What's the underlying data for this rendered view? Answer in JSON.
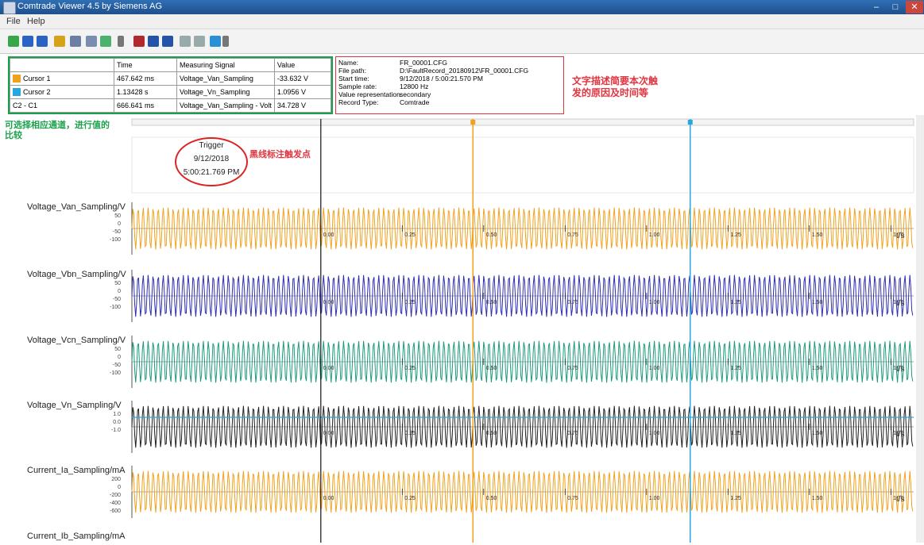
{
  "window": {
    "title": "Comtrade Viewer 4.5 by Siemens AG"
  },
  "menu": [
    "File",
    "Help"
  ],
  "cursor_table": {
    "headers": [
      "",
      "Time",
      "Measuring Signal",
      "Value"
    ],
    "rows": [
      {
        "name": "Cursor 1",
        "color": "#f0a21f",
        "time": "467.642 ms",
        "signal": "Voltage_Van_Sampling",
        "value": "-33.632 V"
      },
      {
        "name": "Cursor 2",
        "color": "#27a7df",
        "time": "1.13428 s",
        "signal": "Voltage_Vn_Sampling",
        "value": "1.0956 V"
      },
      {
        "name": "C2 - C1",
        "color": "",
        "time": "666.641 ms",
        "signal": "Voltage_Van_Sampling - Volt",
        "value": "34.728 V"
      }
    ]
  },
  "record_info": [
    {
      "label": "Name:",
      "value": "FR_00001.CFG"
    },
    {
      "label": "File path:",
      "value": "D:\\FaultRecord_20180912\\FR_00001.CFG"
    },
    {
      "label": "Start time:",
      "value": "9/12/2018 / 5:00:21.570 PM"
    },
    {
      "label": "Sample rate:",
      "value": "12800 Hz"
    },
    {
      "label": "Value representation:",
      "value": "secondary"
    },
    {
      "label": "Record Type:",
      "value": "Comtrade"
    }
  ],
  "annotations": {
    "info_note": "文字描述简要本次触发的原因及时间等",
    "info_note_line1": "文字描述简要本次触",
    "info_note_line2": "发的原因及时间等",
    "channel_note_line1": "可选择相应通道，进行值的",
    "channel_note_line2": "比较",
    "trigger_note": "黑线标注触发点"
  },
  "trigger": {
    "label": "Trigger",
    "date": "9/12/2018",
    "time": "5:00:21.769 PM"
  },
  "time_ticks": [
    "0.00",
    "0.25",
    "0.50",
    "0.75",
    "1.00",
    "1.25",
    "1.50",
    "1.75"
  ],
  "time_unit": "t/s",
  "colors": {
    "orange": "#f0a21f",
    "blue": "#2d2fb0",
    "teal": "#1c9a7c",
    "black": "#202020",
    "cursor1": "#f0a21f",
    "cursor2": "#27a7df"
  },
  "channels": [
    {
      "label": "Voltage_Van_Sampling/V",
      "color": "#f0a21f",
      "ticks": [
        "50",
        "0",
        "-50",
        "-100"
      ]
    },
    {
      "label": "Voltage_Vbn_Sampling/V",
      "color": "#2d2fb0",
      "ticks": [
        "50",
        "0",
        "-50",
        "-100"
      ]
    },
    {
      "label": "Voltage_Vcn_Sampling/V",
      "color": "#1c9a7c",
      "ticks": [
        "50",
        "0",
        "-50",
        "-100"
      ]
    },
    {
      "label": "Voltage_Vn_Sampling/V",
      "color": "#202020",
      "ticks": [
        "1.0",
        "0.0",
        "-1.0"
      ]
    },
    {
      "label": "Current_Ia_Sampling/mA",
      "color": "#f0a21f",
      "ticks": [
        "200",
        "0",
        "-200",
        "-400",
        "-600"
      ]
    },
    {
      "label": "Current_Ib_Sampling/mA",
      "color": "#2d2fb0",
      "ticks": []
    }
  ]
}
